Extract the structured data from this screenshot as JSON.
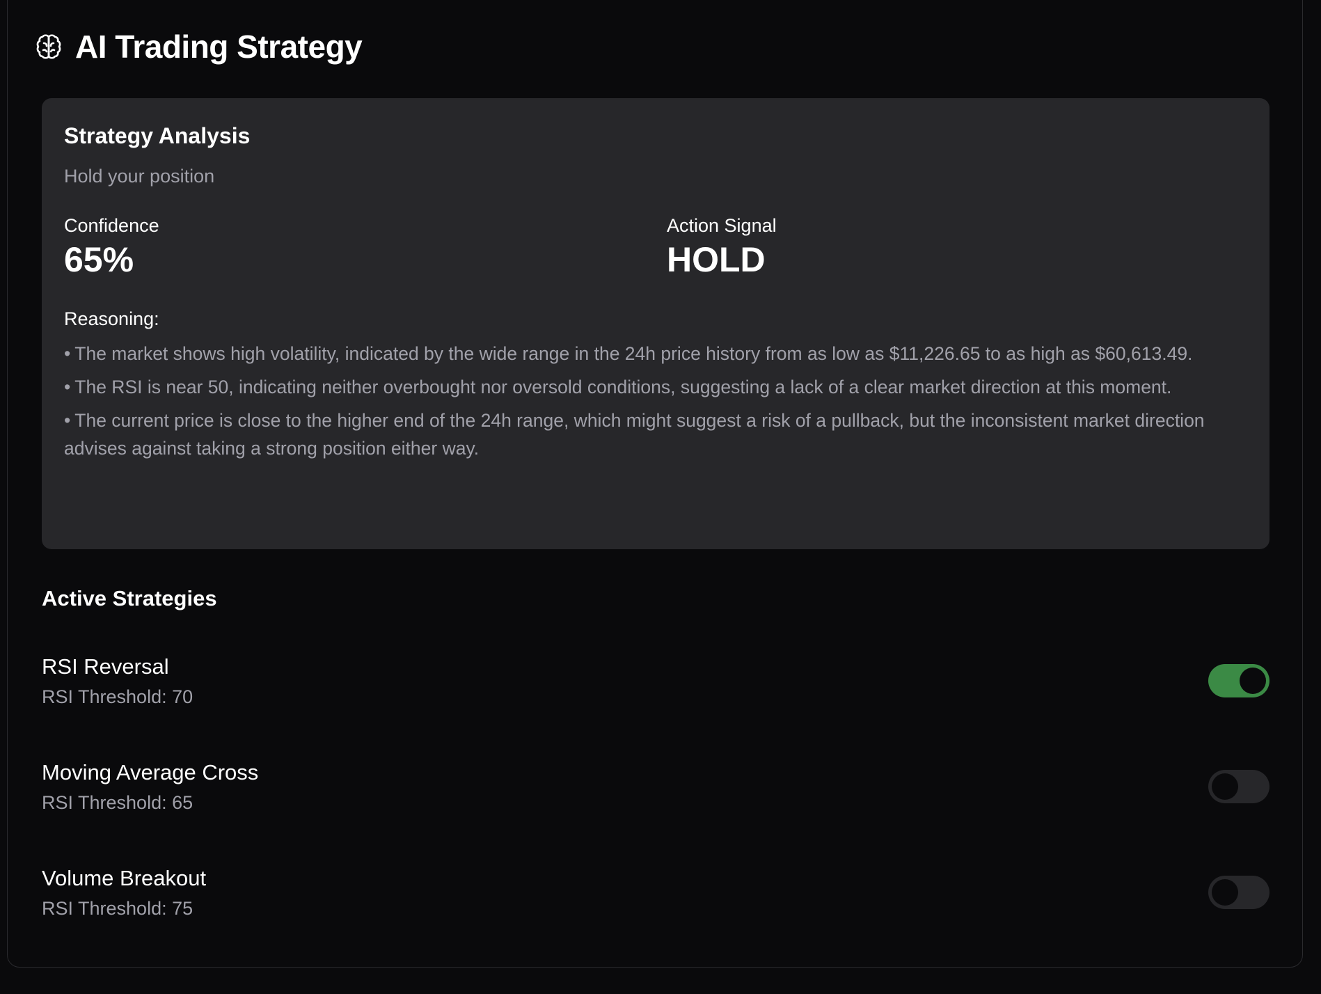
{
  "header": {
    "icon": "brain-icon",
    "title": "AI Trading Strategy"
  },
  "analysis": {
    "title": "Strategy Analysis",
    "subtitle": "Hold your position",
    "confidence_label": "Confidence",
    "confidence_value": "65%",
    "signal_label": "Action Signal",
    "signal_value": "HOLD",
    "reasoning_label": "Reasoning:",
    "reasoning": [
      "The market shows high volatility, indicated by the wide range in the 24h price history from as low as $11,226.65 to as high as $60,613.49.",
      "The RSI is near 50, indicating neither overbought nor oversold conditions, suggesting a lack of a clear market direction at this moment.",
      "The current price is close to the higher end of the 24h range, which might suggest a risk of a pullback, but the inconsistent market direction advises against taking a strong position either way."
    ]
  },
  "active_strategies": {
    "title": "Active Strategies",
    "items": [
      {
        "name": "RSI Reversal",
        "detail": "RSI Threshold: 70",
        "enabled": true
      },
      {
        "name": "Moving Average Cross",
        "detail": "RSI Threshold: 65",
        "enabled": false
      },
      {
        "name": "Volume Breakout",
        "detail": "RSI Threshold: 75",
        "enabled": false
      }
    ]
  },
  "colors": {
    "background": "#0a0a0c",
    "panel": "#27272a",
    "muted_text": "#a1a1aa",
    "toggle_on": "#3b8a45"
  }
}
